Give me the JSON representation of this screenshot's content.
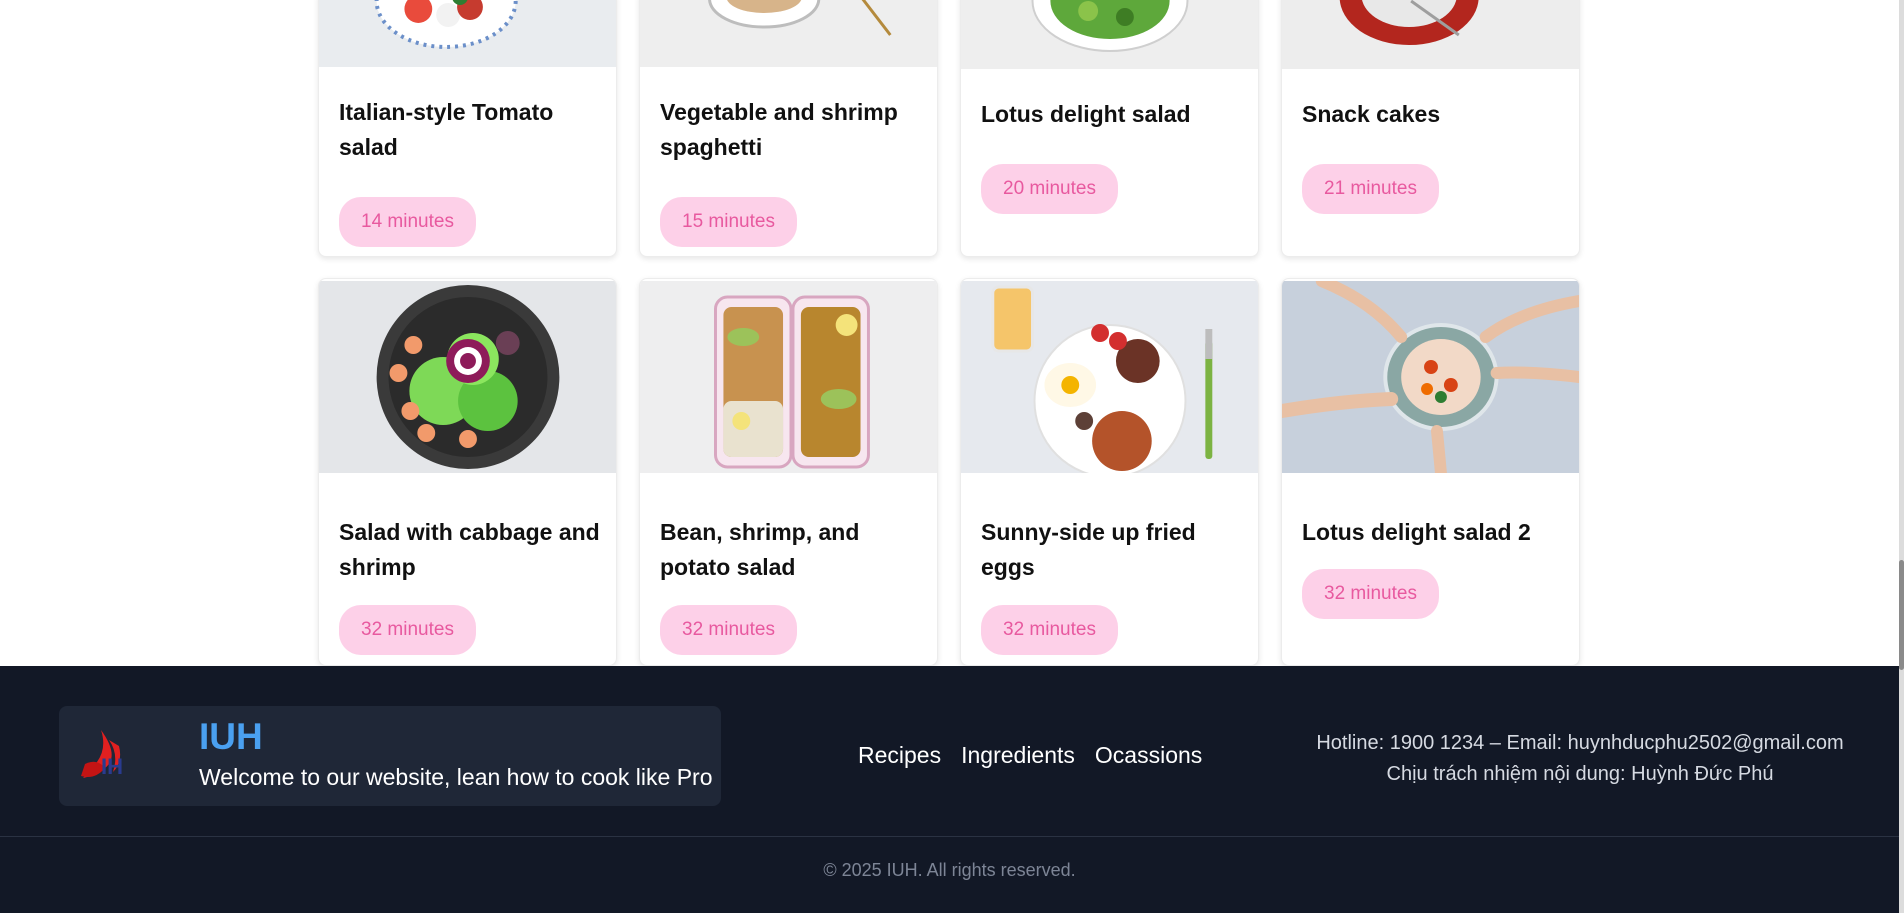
{
  "recipes": [
    {
      "title": "Italian-style Tomato salad",
      "time": "14 minutes"
    },
    {
      "title": "Vegetable and shrimp spaghetti",
      "time": "15 minutes"
    },
    {
      "title": "Lotus delight salad",
      "time": "20 minutes"
    },
    {
      "title": "Snack cakes",
      "time": "21 minutes"
    },
    {
      "title": "Salad with cabbage and shrimp",
      "time": "32 minutes"
    },
    {
      "title": "Bean, shrimp, and potato salad",
      "time": "32 minutes"
    },
    {
      "title": "Sunny-side up fried eggs",
      "time": "32 minutes"
    },
    {
      "title": "Lotus delight salad 2",
      "time": "32 minutes"
    }
  ],
  "footer": {
    "brand_name": "IUH",
    "brand_tagline": "Welcome to our website, lean how to cook like Pro",
    "nav": [
      "Recipes",
      "Ingredients",
      "Ocassions"
    ],
    "contact_line1": "Hotline: 1900 1234 – Email: huynhducphu2502@gmail.com",
    "contact_line2": "Chịu trách nhiệm nội dung: Huỳnh Đức Phú",
    "copyright": "© 2025 IUH. All rights reserved."
  },
  "colors": {
    "badge_bg": "#fdd0e8",
    "badge_text": "#e8599f",
    "footer_bg": "#121826",
    "brand_blue": "#4aa0f0"
  }
}
